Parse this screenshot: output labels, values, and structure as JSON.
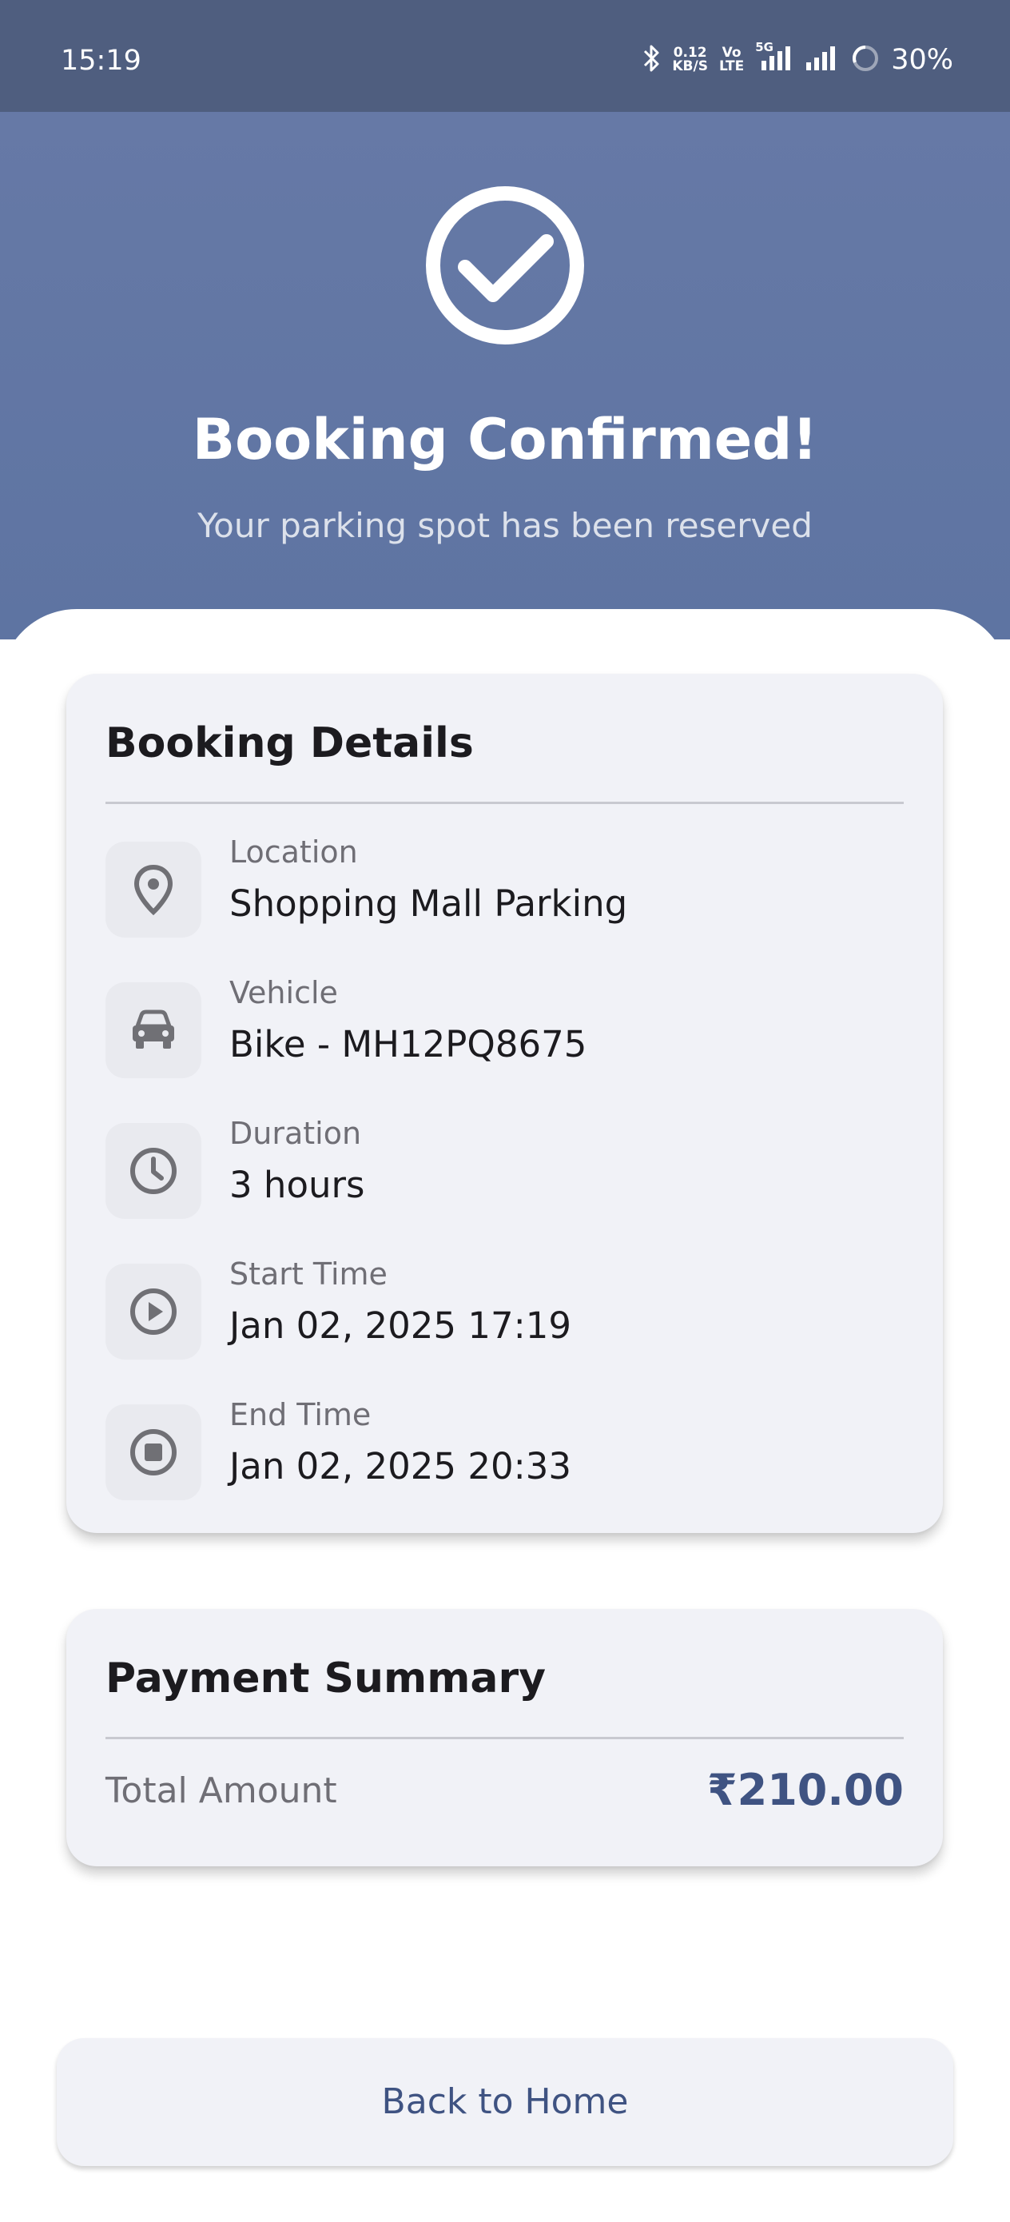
{
  "status_bar": {
    "time": "15:19",
    "network_speed_value": "0.12",
    "network_speed_unit": "KB/S",
    "volte_top": "Vo",
    "volte_bottom": "LTE",
    "network_type": "5G",
    "battery_percent": "30%",
    "icons": [
      "bluetooth-icon",
      "signal-icon",
      "signal-icon",
      "battery-icon"
    ]
  },
  "header": {
    "title": "Booking Confirmed!",
    "subtitle": "Your parking spot has been reserved",
    "icon": "check-circle-icon"
  },
  "booking_details": {
    "title": "Booking Details",
    "items": [
      {
        "label": "Location",
        "value": "Shopping Mall Parking",
        "icon": "location-pin-icon"
      },
      {
        "label": "Vehicle",
        "value": "Bike - MH12PQ8675",
        "icon": "car-icon"
      },
      {
        "label": "Duration",
        "value": "3 hours",
        "icon": "clock-icon"
      },
      {
        "label": "Start Time",
        "value": "Jan 02, 2025 17:19",
        "icon": "play-circle-icon"
      },
      {
        "label": "End Time",
        "value": "Jan 02, 2025 20:33",
        "icon": "stop-circle-icon"
      }
    ]
  },
  "payment_summary": {
    "title": "Payment Summary",
    "total_label": "Total Amount",
    "total_value": "₹210.00"
  },
  "actions": {
    "back_home_label": "Back to Home"
  },
  "colors": {
    "status_bar": "#4f5e7f",
    "hero": "#6277a4",
    "accent": "#3f5382",
    "card_bg": "#f1f2f7"
  }
}
